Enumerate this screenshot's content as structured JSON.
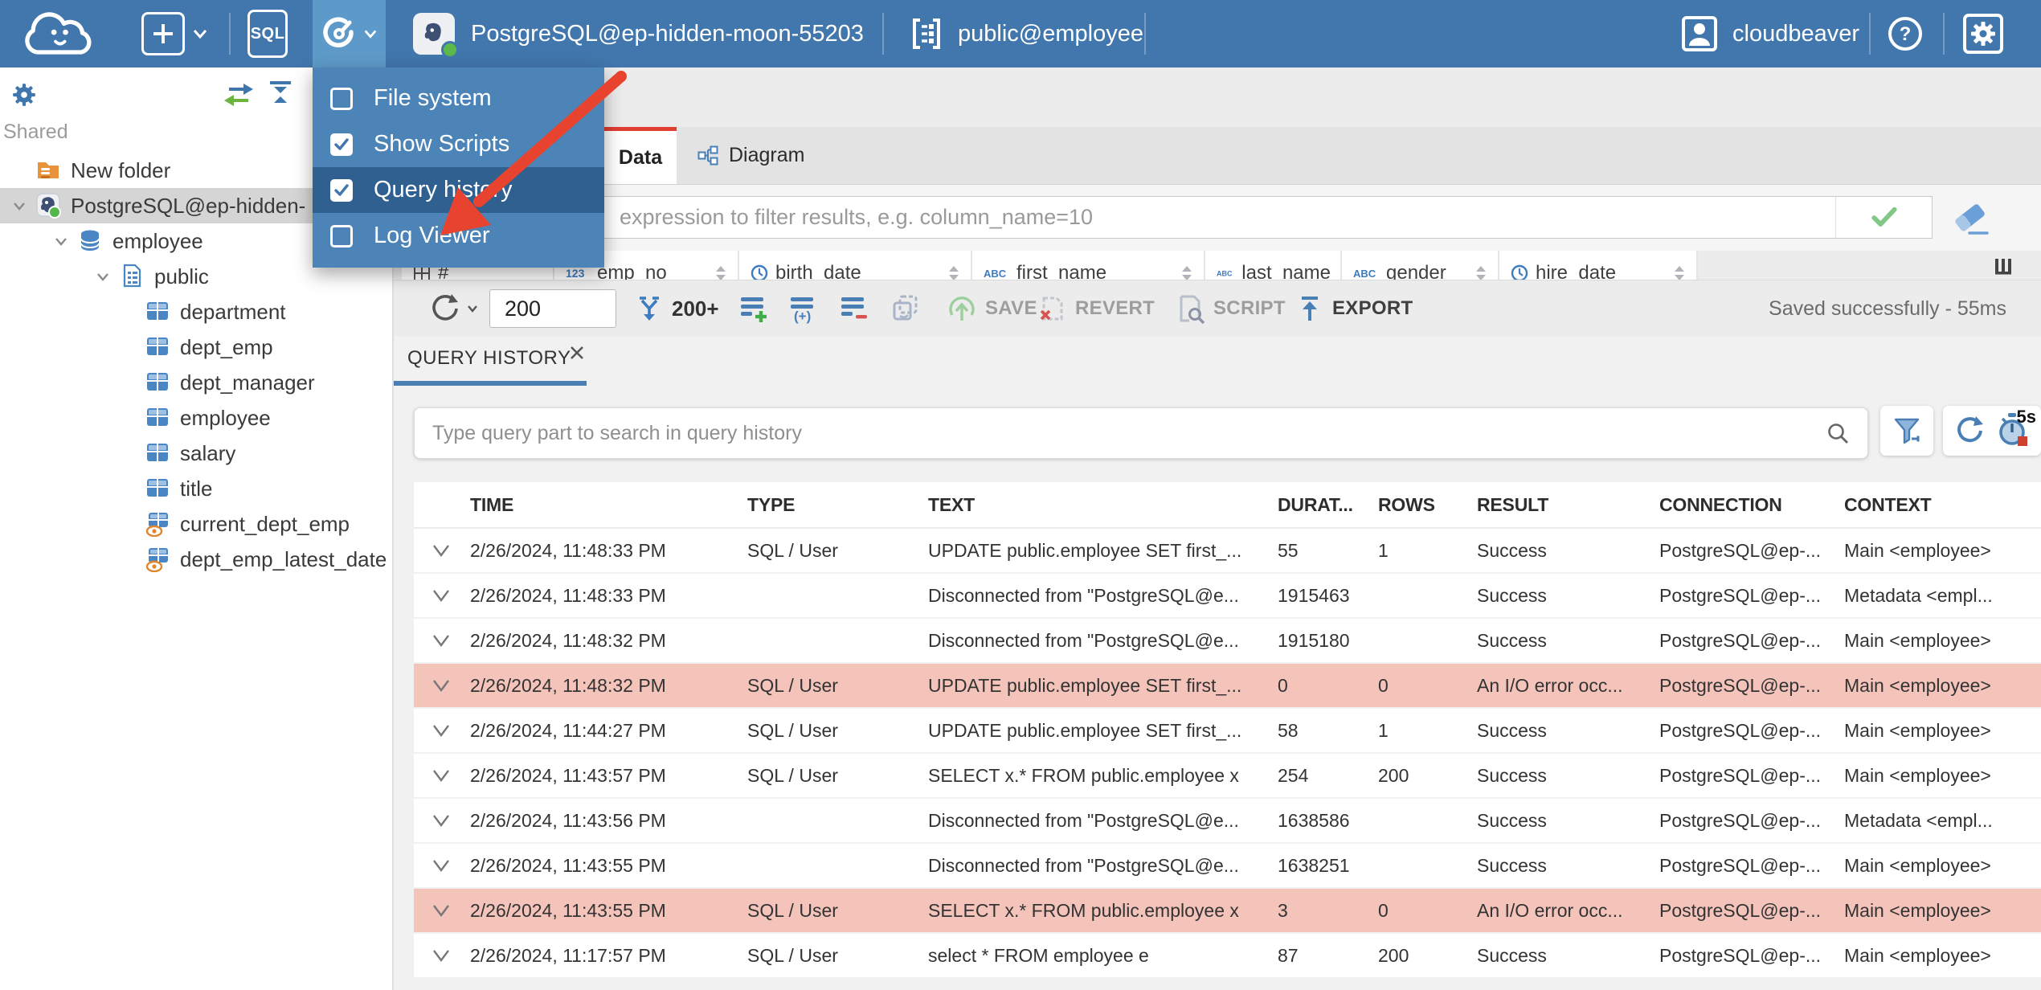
{
  "topbar": {
    "sql_button_label": "SQL",
    "connection_label": "PostgreSQL@ep-hidden-moon-55203",
    "schema_label": "public@employee",
    "user_label": "cloudbeaver"
  },
  "menu": {
    "items": [
      {
        "label": "File system",
        "checked": false,
        "highlighted": false
      },
      {
        "label": "Show Scripts",
        "checked": true,
        "highlighted": false
      },
      {
        "label": "Query history",
        "checked": true,
        "highlighted": true
      },
      {
        "label": "Log Viewer",
        "checked": false,
        "highlighted": false
      }
    ]
  },
  "sidebar": {
    "section_label": "Shared",
    "tree": [
      {
        "label": "New folder",
        "icon": "folder",
        "level": 0,
        "chevron": false,
        "selected": false
      },
      {
        "label": "PostgreSQL@ep-hidden-",
        "icon": "postgres",
        "level": 0,
        "chevron": true,
        "selected": true
      },
      {
        "label": "employee",
        "icon": "database",
        "level": 1,
        "chevron": true,
        "selected": false
      },
      {
        "label": "public",
        "icon": "schema",
        "level": 2,
        "chevron": true,
        "selected": false
      },
      {
        "label": "department",
        "icon": "table",
        "level": 3,
        "chevron": false,
        "selected": false
      },
      {
        "label": "dept_emp",
        "icon": "table",
        "level": 3,
        "chevron": false,
        "selected": false
      },
      {
        "label": "dept_manager",
        "icon": "table",
        "level": 3,
        "chevron": false,
        "selected": false
      },
      {
        "label": "employee",
        "icon": "table",
        "level": 3,
        "chevron": false,
        "selected": false
      },
      {
        "label": "salary",
        "icon": "table",
        "level": 3,
        "chevron": false,
        "selected": false
      },
      {
        "label": "title",
        "icon": "table",
        "level": 3,
        "chevron": false,
        "selected": false
      },
      {
        "label": "current_dept_emp",
        "icon": "view",
        "level": 3,
        "chevron": false,
        "selected": false
      },
      {
        "label": "dept_emp_latest_date",
        "icon": "view",
        "level": 3,
        "chevron": false,
        "selected": false
      }
    ]
  },
  "editor": {
    "tabs": {
      "data": "Data",
      "diagram": "Diagram"
    },
    "filter_placeholder": "expression to filter results, e.g. column_name=10",
    "grid_columns": [
      "#",
      "emp_no",
      "birth_date",
      "first_name",
      "last_name",
      "gender",
      "hire_date"
    ],
    "toolbar": {
      "row_limit": "200",
      "fetch_label": "200+",
      "save_label": "SAVE",
      "revert_label": "REVERT",
      "script_label": "SCRIPT",
      "export_label": "EXPORT",
      "status": "Saved successfully - 55ms"
    }
  },
  "query_history": {
    "tab_label": "QUERY HISTORY",
    "search_placeholder": "Type query part to search in query history",
    "refresh_interval": "5s",
    "columns": [
      "TIME",
      "TYPE",
      "TEXT",
      "DURAT...",
      "ROWS",
      "RESULT",
      "CONNECTION",
      "CONTEXT"
    ],
    "rows": [
      {
        "time": "2/26/2024, 11:48:33 PM",
        "type": "SQL / User",
        "text": "UPDATE public.employee SET first_...",
        "duration": "55",
        "rows": "1",
        "result": "Success",
        "connection": "PostgreSQL@ep-...",
        "context": "Main <employee>",
        "error": false
      },
      {
        "time": "2/26/2024, 11:48:33 PM",
        "type": "",
        "text": "Disconnected from \"PostgreSQL@e...",
        "duration": "1915463",
        "rows": "",
        "result": "Success",
        "connection": "PostgreSQL@ep-...",
        "context": "Metadata <empl...",
        "error": false
      },
      {
        "time": "2/26/2024, 11:48:32 PM",
        "type": "",
        "text": "Disconnected from \"PostgreSQL@e...",
        "duration": "1915180",
        "rows": "",
        "result": "Success",
        "connection": "PostgreSQL@ep-...",
        "context": "Main <employee>",
        "error": false
      },
      {
        "time": "2/26/2024, 11:48:32 PM",
        "type": "SQL / User",
        "text": "UPDATE public.employee SET first_...",
        "duration": "0",
        "rows": "0",
        "result": "An I/O error occ...",
        "connection": "PostgreSQL@ep-...",
        "context": "Main <employee>",
        "error": true
      },
      {
        "time": "2/26/2024, 11:44:27 PM",
        "type": "SQL / User",
        "text": "UPDATE public.employee SET first_...",
        "duration": "58",
        "rows": "1",
        "result": "Success",
        "connection": "PostgreSQL@ep-...",
        "context": "Main <employee>",
        "error": false
      },
      {
        "time": "2/26/2024, 11:43:57 PM",
        "type": "SQL / User",
        "text": "SELECT x.* FROM public.employee x",
        "duration": "254",
        "rows": "200",
        "result": "Success",
        "connection": "PostgreSQL@ep-...",
        "context": "Main <employee>",
        "error": false
      },
      {
        "time": "2/26/2024, 11:43:56 PM",
        "type": "",
        "text": "Disconnected from \"PostgreSQL@e...",
        "duration": "1638586",
        "rows": "",
        "result": "Success",
        "connection": "PostgreSQL@ep-...",
        "context": "Metadata <empl...",
        "error": false
      },
      {
        "time": "2/26/2024, 11:43:55 PM",
        "type": "",
        "text": "Disconnected from \"PostgreSQL@e...",
        "duration": "1638251",
        "rows": "",
        "result": "Success",
        "connection": "PostgreSQL@ep-...",
        "context": "Main <employee>",
        "error": false
      },
      {
        "time": "2/26/2024, 11:43:55 PM",
        "type": "SQL / User",
        "text": "SELECT x.* FROM public.employee x",
        "duration": "3",
        "rows": "0",
        "result": "An I/O error occ...",
        "connection": "PostgreSQL@ep-...",
        "context": "Main <employee>",
        "error": true
      },
      {
        "time": "2/26/2024, 11:17:57 PM",
        "type": "SQL / User",
        "text": "select * FROM employee e",
        "duration": "87",
        "rows": "200",
        "result": "Success",
        "connection": "PostgreSQL@ep-...",
        "context": "Main <employee>",
        "error": false
      }
    ]
  }
}
